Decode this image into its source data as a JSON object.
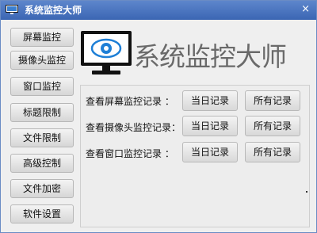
{
  "window": {
    "title": "系统监控大师",
    "close_glyph": "×"
  },
  "brand": {
    "text": "系统监控大师",
    "logo_icon": "monitor-eye-icon",
    "accent": "#1e7fd6"
  },
  "sidebar": {
    "items": [
      {
        "label": "屏幕监控"
      },
      {
        "label": "摄像头监控"
      },
      {
        "label": "窗口监控"
      },
      {
        "label": "标题限制"
      },
      {
        "label": "文件限制"
      },
      {
        "label": "高级控制"
      },
      {
        "label": "文件加密"
      },
      {
        "label": "软件设置"
      }
    ]
  },
  "records": {
    "rows": [
      {
        "label": "查看屏幕监控记录 ：",
        "today": "当日记录",
        "all": "所有记录"
      },
      {
        "label": "查看摄像头监控记录：",
        "today": "当日记录",
        "all": "所有记录"
      },
      {
        "label": "查看窗口监控记录 ：",
        "today": "当日记录",
        "all": "所有记录"
      }
    ]
  }
}
